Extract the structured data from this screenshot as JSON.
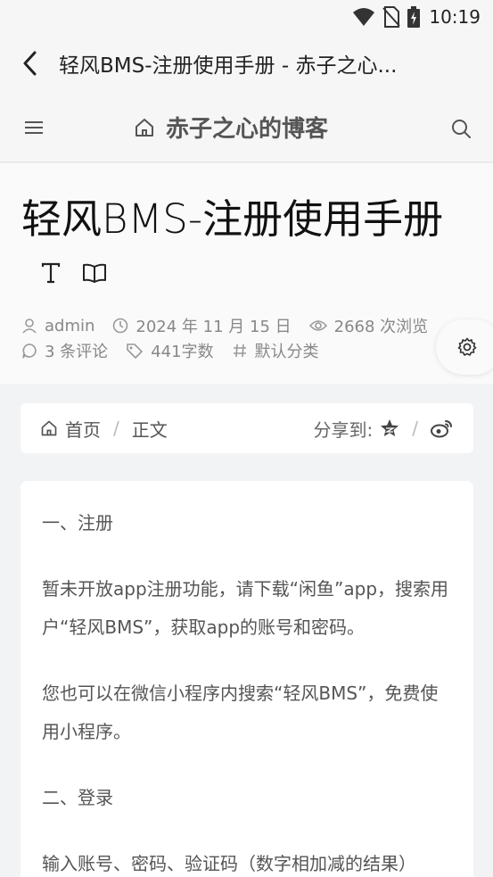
{
  "status_bar": {
    "time": "10:19",
    "icons": [
      "wifi-icon",
      "no-sim-icon",
      "battery-charging-icon"
    ]
  },
  "app_bar": {
    "back_icon": "back-arrow-icon",
    "title": "轻风BMS-注册使用手册 - 赤子之心..."
  },
  "site_header": {
    "menu_icon": "hamburger-menu-icon",
    "home_icon": "home-icon",
    "site_name": "赤子之心的博客",
    "search_icon": "search-icon"
  },
  "article": {
    "title_cn1": "轻风",
    "title_latin": "BMS-",
    "title_cn2": "注册使用手册",
    "tools": [
      "font-size-icon",
      "reading-mode-icon"
    ],
    "meta": {
      "author": "admin",
      "date": "2024 年 11 月 15 日",
      "views": "2668 次浏览",
      "comments": "3 条评论",
      "words": "441字数",
      "category": "默认分类"
    },
    "settings_icon": "gear-icon"
  },
  "breadcrumb": {
    "home": "首页",
    "separator": "/",
    "current": "正文",
    "share_label": "分享到:",
    "share_separator": "/",
    "share_icons": [
      "qzone-star-icon",
      "weibo-icon"
    ]
  },
  "content": {
    "paragraphs": [
      "一、注册",
      "暂未开放app注册功能，请下载“闲鱼”app，搜索用户“轻风BMS”，获取app的账号和密码。",
      "您也可以在微信小程序内搜索“轻风BMS”，免费使用小程序。",
      "二、登录",
      "输入账号、密码、验证码（数字相加减的结果）"
    ]
  },
  "colors": {
    "header_bg": "#f6f6f6",
    "page_bg": "#f2f3f5",
    "card_bg": "#ffffff",
    "meta_text": "#888888",
    "title_text": "#111111"
  }
}
